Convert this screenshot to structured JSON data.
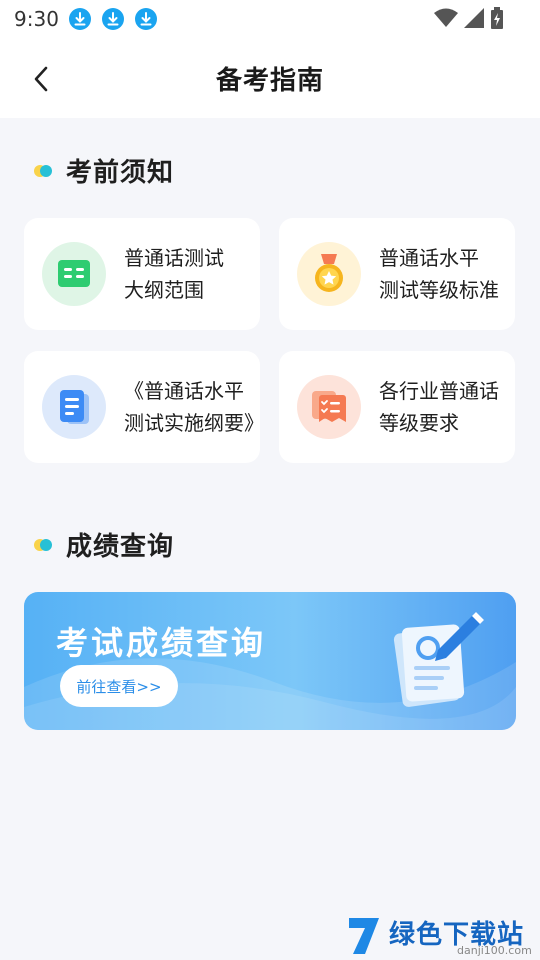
{
  "status_bar": {
    "time": "9:30"
  },
  "header": {
    "title": "备考指南"
  },
  "sections": {
    "pre_exam": {
      "title": "考前须知"
    },
    "score": {
      "title": "成绩查询"
    }
  },
  "cards": [
    {
      "line1": "普通话测试",
      "line2": "大纲范围",
      "icon": "book-icon",
      "color": "#2ecc71"
    },
    {
      "line1": "普通话水平",
      "line2": "测试等级标准",
      "icon": "medal-icon",
      "color": "#f6b51e"
    },
    {
      "line1": "《普通话水平",
      "line2": "测试实施纲要》",
      "icon": "document-icon",
      "color": "#3d8bf5"
    },
    {
      "line1": "各行业普通话",
      "line2": "等级要求",
      "icon": "checklist-icon",
      "color": "#f57a52"
    }
  ],
  "banner": {
    "title": "考试成绩查询",
    "button_label": "前往查看>>"
  },
  "watermark": {
    "text": "绿色下载站",
    "url": "danji100.com"
  },
  "colors": {
    "accent_blue": "#2b8ee8",
    "background": "#f5f6fa",
    "dot_yellow": "#f9d34a",
    "dot_cyan": "#27c0d6"
  }
}
